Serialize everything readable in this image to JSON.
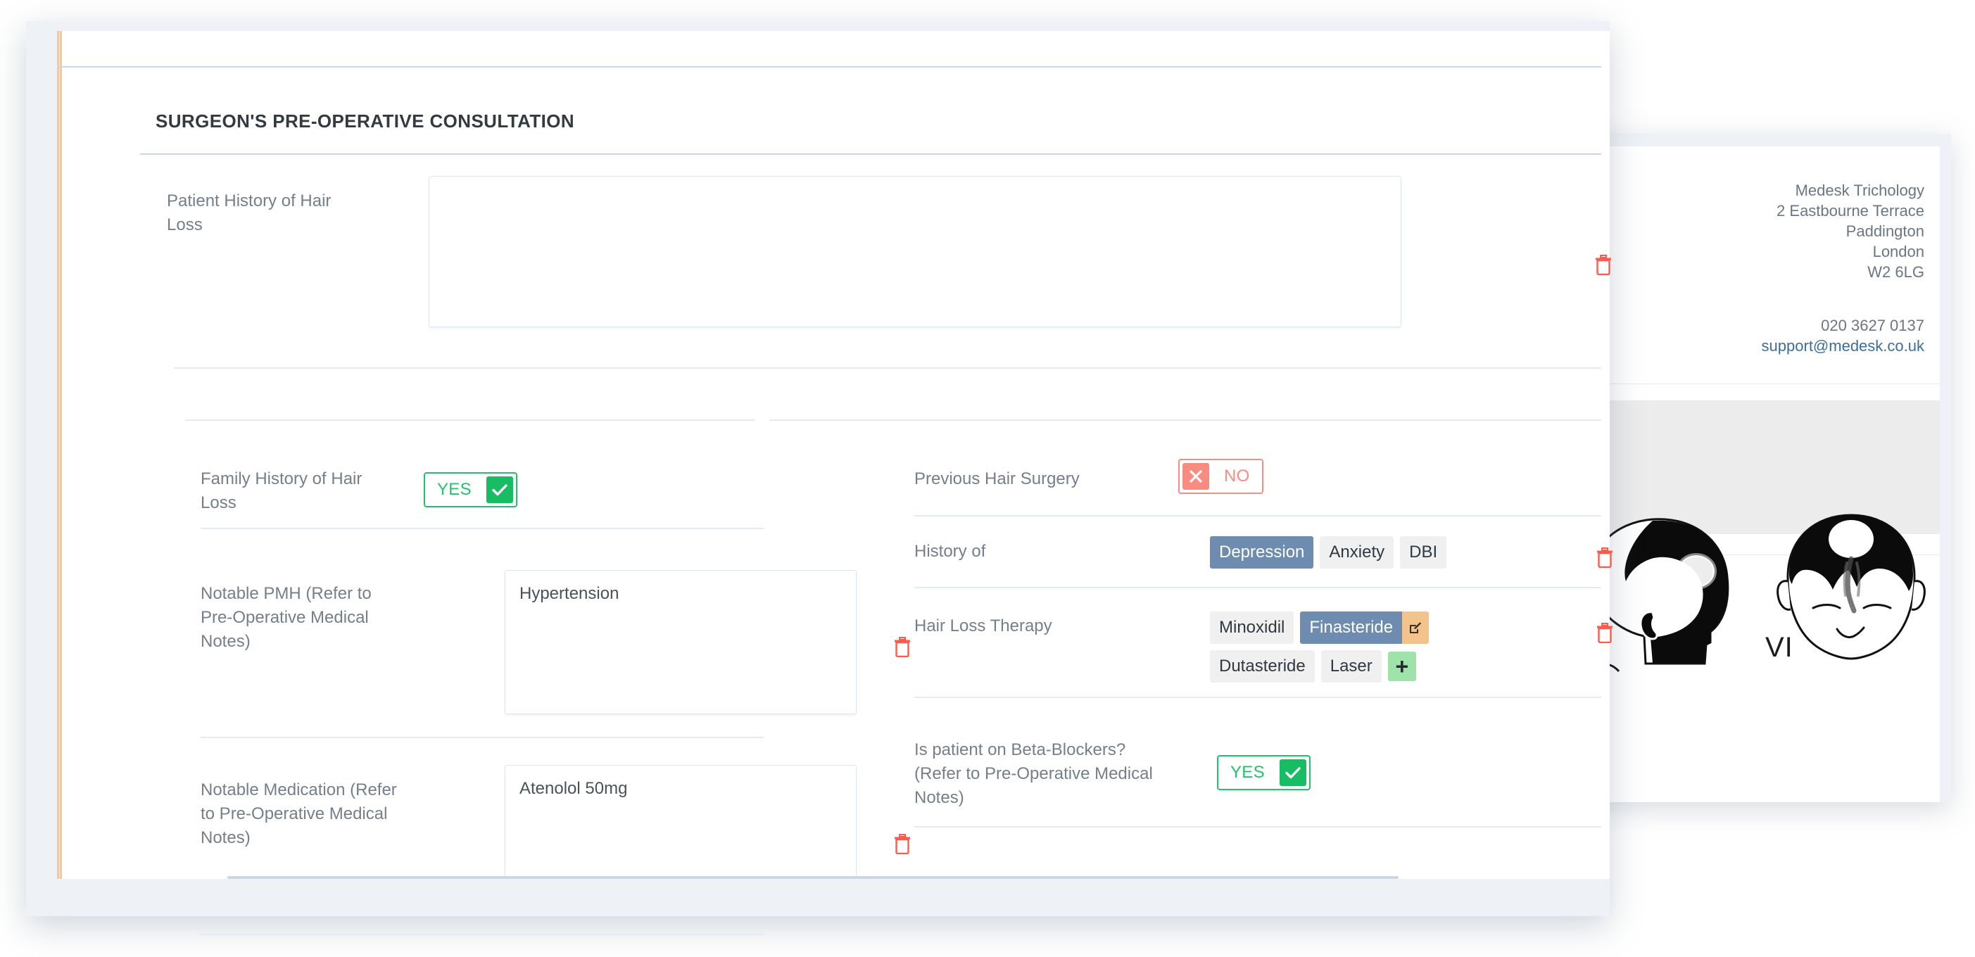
{
  "clinic": {
    "name": "Medesk Trichology",
    "address_line1": "2 Eastbourne Terrace",
    "address_line2": "Paddington",
    "city": "London",
    "postcode": "W2 6LG",
    "phone": "020 3627 0137",
    "email": "support@medesk.co.uk",
    "norwood_stage": "VI"
  },
  "card": {
    "title": "SURGEON'S PRE-OPERATIVE CONSULTATION"
  },
  "fields": {
    "patient_history": {
      "label": "Patient History of Hair Loss",
      "value": "",
      "delete_label": "trash-icon"
    },
    "family_history": {
      "label": "Family History of Hair Loss",
      "toggle_value": "YES",
      "toggle_state": "yes"
    },
    "notable_pmh": {
      "label": "Notable PMH (Refer to Pre-Operative Medical Notes)",
      "value": "Hypertension"
    },
    "notable_medication": {
      "label": "Notable Medication (Refer to Pre-Operative Medical Notes)",
      "value": "Atenolol 50mg"
    },
    "previous_hair_surgery": {
      "label": "Previous Hair Surgery",
      "toggle_value": "NO",
      "toggle_state": "no"
    },
    "history_of": {
      "label": "History of",
      "options": [
        {
          "label": "Depression",
          "selected": true
        },
        {
          "label": "Anxiety",
          "selected": false
        },
        {
          "label": "DBI",
          "selected": false
        }
      ]
    },
    "hair_loss_therapy": {
      "label": "Hair Loss Therapy",
      "options": [
        {
          "label": "Minoxidil",
          "selected": false
        },
        {
          "label": "Finasteride",
          "selected": true,
          "has_edit": true
        },
        {
          "label": "Dutasteride",
          "selected": false
        },
        {
          "label": "Laser",
          "selected": false
        }
      ],
      "add_label": "+"
    },
    "beta_blockers": {
      "label": "Is patient on Beta-Blockers? (Refer to Pre-Operative Medical Notes)",
      "toggle_value": "YES",
      "toggle_state": "yes"
    }
  },
  "colors": {
    "accent_orange": "#f6c79a",
    "yes_green": "#18bd63",
    "no_red": "#f98b80",
    "tag_selected_blue": "#6d8caf",
    "tag_edit_orange": "#f2c48c",
    "tag_add_green": "#9fe3ab",
    "trash_red": "#fc5b4e",
    "link_blue": "#3c6e9c"
  }
}
